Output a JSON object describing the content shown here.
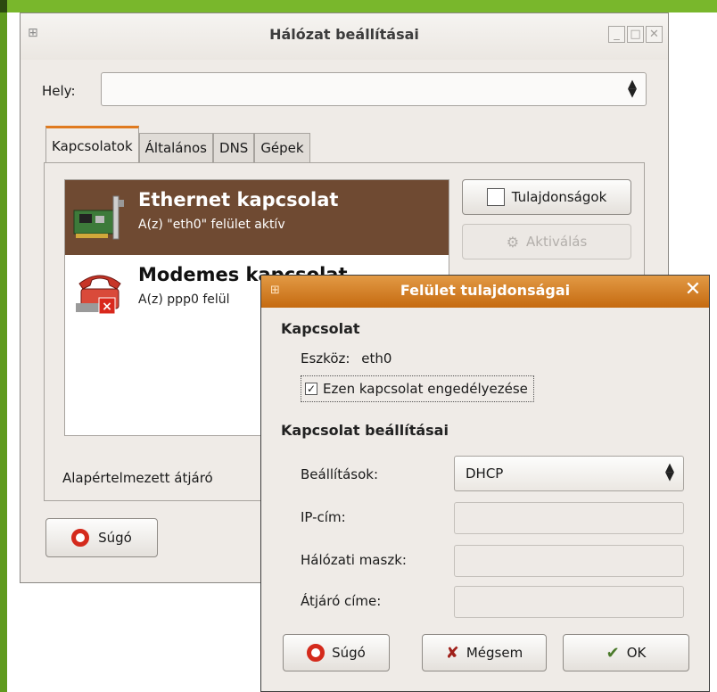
{
  "main_window": {
    "title": "Hálózat beállításai",
    "location_label": "Hely:",
    "location_value": "",
    "tabs": [
      {
        "label": "Kapcsolatok",
        "active": true
      },
      {
        "label": "Általános",
        "active": false
      },
      {
        "label": "DNS",
        "active": false
      },
      {
        "label": "Gépek",
        "active": false
      }
    ],
    "connections": [
      {
        "name": "Ethernet kapcsolat",
        "description": "A(z) \"eth0\" felület aktív",
        "selected": true,
        "icon": "network-card-icon"
      },
      {
        "name": "Modemes kapcsolat",
        "description": "A(z) ppp0 felül",
        "selected": false,
        "icon": "modem-phone-icon"
      }
    ],
    "properties_button": "Tulajdonságok",
    "activate_button": "Aktiválás",
    "gateway_label": "Alapértelmezett átjáró",
    "help_button": "Súgó"
  },
  "dialog": {
    "title": "Felület tulajdonságai",
    "section_connection": "Kapcsolat",
    "device_label": "Eszköz:",
    "device_value": "eth0",
    "enable_checkbox_label": "Ezen kapcsolat engedélyezése",
    "enable_checked": true,
    "section_settings": "Kapcsolat beállításai",
    "settings_label": "Beállítások:",
    "settings_value": "DHCP",
    "ip_label": "IP-cím:",
    "mask_label": "Hálózati maszk:",
    "gateway_address_label": "Átjáró címe:",
    "help_button": "Súgó",
    "cancel_button": "Mégsem",
    "ok_button": "OK"
  },
  "colors": {
    "selection": "#6f4a32",
    "dialog_title": "#d67f22",
    "window_bg": "#efebe7",
    "page_accent": "#79b72c"
  }
}
